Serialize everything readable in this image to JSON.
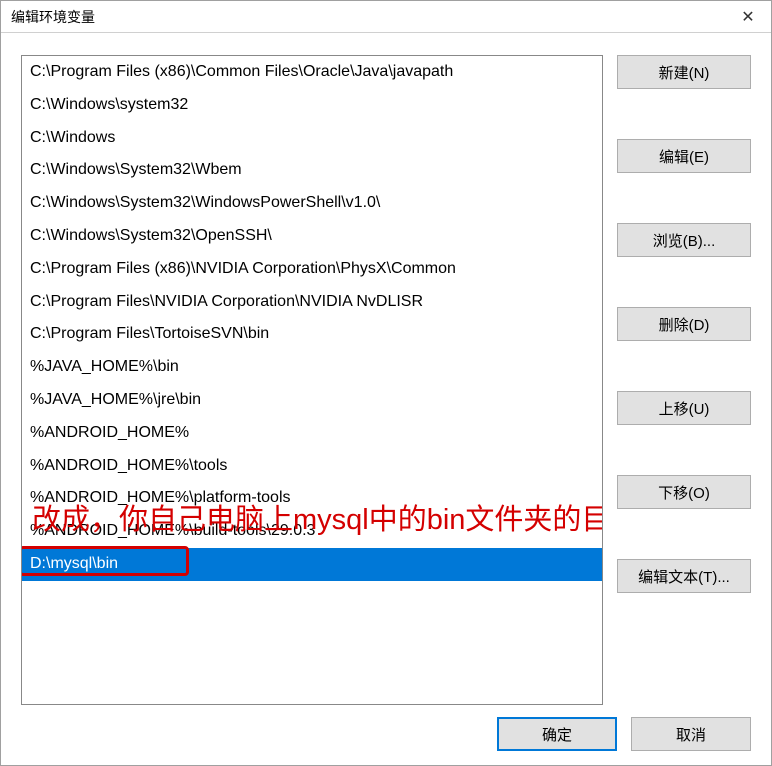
{
  "title": "编辑环境变量",
  "list_items": [
    "C:\\Program Files (x86)\\Common Files\\Oracle\\Java\\javapath",
    "C:\\Windows\\system32",
    "C:\\Windows",
    "C:\\Windows\\System32\\Wbem",
    "C:\\Windows\\System32\\WindowsPowerShell\\v1.0\\",
    "C:\\Windows\\System32\\OpenSSH\\",
    "C:\\Program Files (x86)\\NVIDIA Corporation\\PhysX\\Common",
    "C:\\Program Files\\NVIDIA Corporation\\NVIDIA NvDLISR",
    "C:\\Program Files\\TortoiseSVN\\bin",
    "%JAVA_HOME%\\bin",
    "%JAVA_HOME%\\jre\\bin",
    "%ANDROID_HOME%",
    "%ANDROID_HOME%\\tools",
    "%ANDROID_HOME%\\platform-tools",
    "%ANDROID_HOME%\\build-tools\\29.0.3",
    "D:\\mysql\\bin"
  ],
  "selected_index": 15,
  "buttons": {
    "new": "新建(N)",
    "edit": "编辑(E)",
    "browse": "浏览(B)...",
    "delete": "删除(D)",
    "move_up": "上移(U)",
    "move_down": "下移(O)",
    "edit_text": "编辑文本(T)...",
    "ok": "确定",
    "cancel": "取消"
  },
  "annotation": "改成，你自己电脑上mysql中的bin文件夹的目录"
}
